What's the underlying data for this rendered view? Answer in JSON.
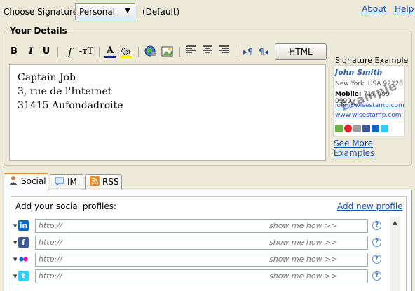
{
  "top": {
    "choose_label": "Choose Signature",
    "selected_signature": "Personal",
    "default_label": "(Default)",
    "about": "About",
    "help": "Help"
  },
  "details": {
    "legend": "Your Details",
    "toolbar": {
      "bold": "B",
      "italic": "I",
      "underline": "U",
      "font": "ƒ",
      "font_size": "-тT",
      "text_color": "A",
      "html_button": "HTML"
    },
    "editor_lines": [
      "Captain Job",
      "3, rue de l'Internet",
      "31415 Aufondadroite"
    ]
  },
  "example": {
    "title": "Signature Example",
    "name": "John Smith",
    "location": "New York, USA 92228",
    "mobile_label": "Mobile:",
    "mobile_value": "717-999-0999",
    "email": "john@wisestamp.com",
    "website": "www.wisestamp.com",
    "watermark": "Example",
    "see_more": "See More Examples"
  },
  "tabs": [
    {
      "label": "Social",
      "active": true
    },
    {
      "label": "IM",
      "active": false
    },
    {
      "label": "RSS",
      "active": false
    }
  ],
  "social": {
    "add_label": "Add your social profiles:",
    "add_new_link": "Add new profile",
    "rows": [
      {
        "network": "linkedin",
        "placeholder": "http://",
        "show_me": "show me how >>",
        "color": "#0a66c2",
        "glyph": "in"
      },
      {
        "network": "facebook",
        "placeholder": "http://",
        "show_me": "show me how >>",
        "color": "#3b5998",
        "glyph": "f"
      },
      {
        "network": "flickr",
        "placeholder": "http://",
        "show_me": "show me how >>",
        "color": "#ffffff",
        "glyph": ""
      },
      {
        "network": "twitter",
        "placeholder": "http://",
        "show_me": "show me how >>",
        "color": "#33ccff",
        "glyph": "t"
      }
    ]
  },
  "colors": {
    "link": "#1a4fae",
    "background": "#ece9d8",
    "tab_accent": "#e68b2c"
  }
}
